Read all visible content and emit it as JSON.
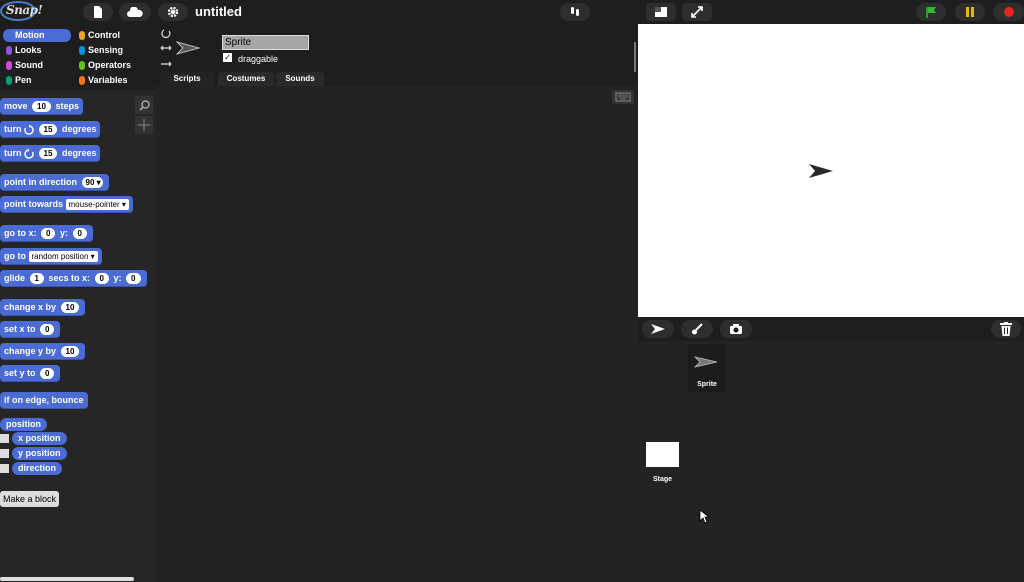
{
  "app": {
    "title": "untitled",
    "logo_text": "Snap!"
  },
  "categories": [
    {
      "label": "Motion",
      "color": "#4a6cd4",
      "selected": true
    },
    {
      "label": "Control",
      "color": "#e6a822"
    },
    {
      "label": "Looks",
      "color": "#8f56e3"
    },
    {
      "label": "Sensing",
      "color": "#0494dc"
    },
    {
      "label": "Sound",
      "color": "#cf4ad9"
    },
    {
      "label": "Operators",
      "color": "#62c213"
    },
    {
      "label": "Pen",
      "color": "#00a178"
    },
    {
      "label": "Variables",
      "color": "#f3761d"
    }
  ],
  "blocks": {
    "move": {
      "label": "move",
      "value": "10",
      "suffix": "steps"
    },
    "turn_cw": {
      "label": "turn",
      "icon": "rotate-cw-icon",
      "value": "15",
      "suffix": "degrees"
    },
    "turn_ccw": {
      "label": "turn",
      "icon": "rotate-ccw-icon",
      "value": "15",
      "suffix": "degrees"
    },
    "point_dir": {
      "label": "point in direction",
      "value": "90"
    },
    "point_towards": {
      "label": "point towards",
      "value": "mouse-pointer"
    },
    "goto_xy": {
      "label": "go to x:",
      "x": "0",
      "ylabel": "y:",
      "y": "0"
    },
    "goto": {
      "label": "go to",
      "value": "random position"
    },
    "glide": {
      "label": "glide",
      "secs": "1",
      "mid": "secs to x:",
      "x": "0",
      "ylabel": "y:",
      "y": "0"
    },
    "change_x": {
      "label": "change x by",
      "value": "10"
    },
    "set_x": {
      "label": "set x to",
      "value": "0"
    },
    "change_y": {
      "label": "change y by",
      "value": "10"
    },
    "set_y": {
      "label": "set y to",
      "value": "0"
    },
    "bounce": {
      "label": "if on edge, bounce"
    },
    "position": {
      "label": "position"
    },
    "x_position": {
      "label": "x position"
    },
    "y_position": {
      "label": "y position"
    },
    "direction": {
      "label": "direction"
    }
  },
  "make_block": "Make a block",
  "sprite": {
    "name": "Sprite",
    "draggable_label": "draggable",
    "draggable": true
  },
  "tabs": [
    "Scripts",
    "Costumes",
    "Sounds"
  ],
  "corral": {
    "sprite_label": "Sprite",
    "stage_label": "Stage"
  },
  "colors": {
    "motion": "#4a6cd4",
    "accent": "#4a7cc8",
    "flag": "#2ebd2e",
    "pause": "#e6b800",
    "stop": "#e62222"
  }
}
